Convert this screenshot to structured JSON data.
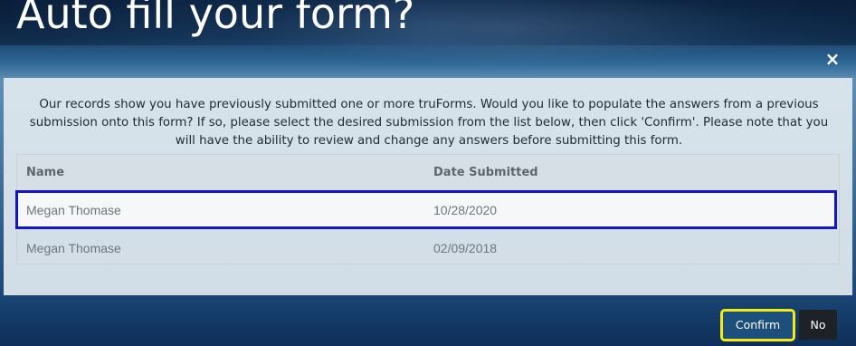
{
  "page": {
    "title": "Auto fill your form?"
  },
  "dialog": {
    "close_symbol": "×",
    "message": "Our records show you have previously submitted one or more truForms. Would you like to populate the answers from a previous submission onto this form? If so, please select the desired submission from the list below, then click 'Confirm'. Please note that you will have the ability to review and change any answers before submitting this form.",
    "table": {
      "columns": [
        "Name",
        "Date Submitted"
      ],
      "rows": [
        {
          "name": "Megan Thomase",
          "date": "10/28/2020",
          "selected": true
        },
        {
          "name": "Megan Thomase",
          "date": "02/09/2018",
          "selected": false
        }
      ]
    },
    "buttons": {
      "confirm_label": "Confirm",
      "no_label": "No"
    }
  },
  "colors": {
    "selected_row_border": "#1414c8",
    "confirm_highlight": "#f2ea14",
    "confirm_bg": "#1c4f7c",
    "no_bg": "#1e2226"
  },
  "icons": {
    "close": "close-icon"
  }
}
